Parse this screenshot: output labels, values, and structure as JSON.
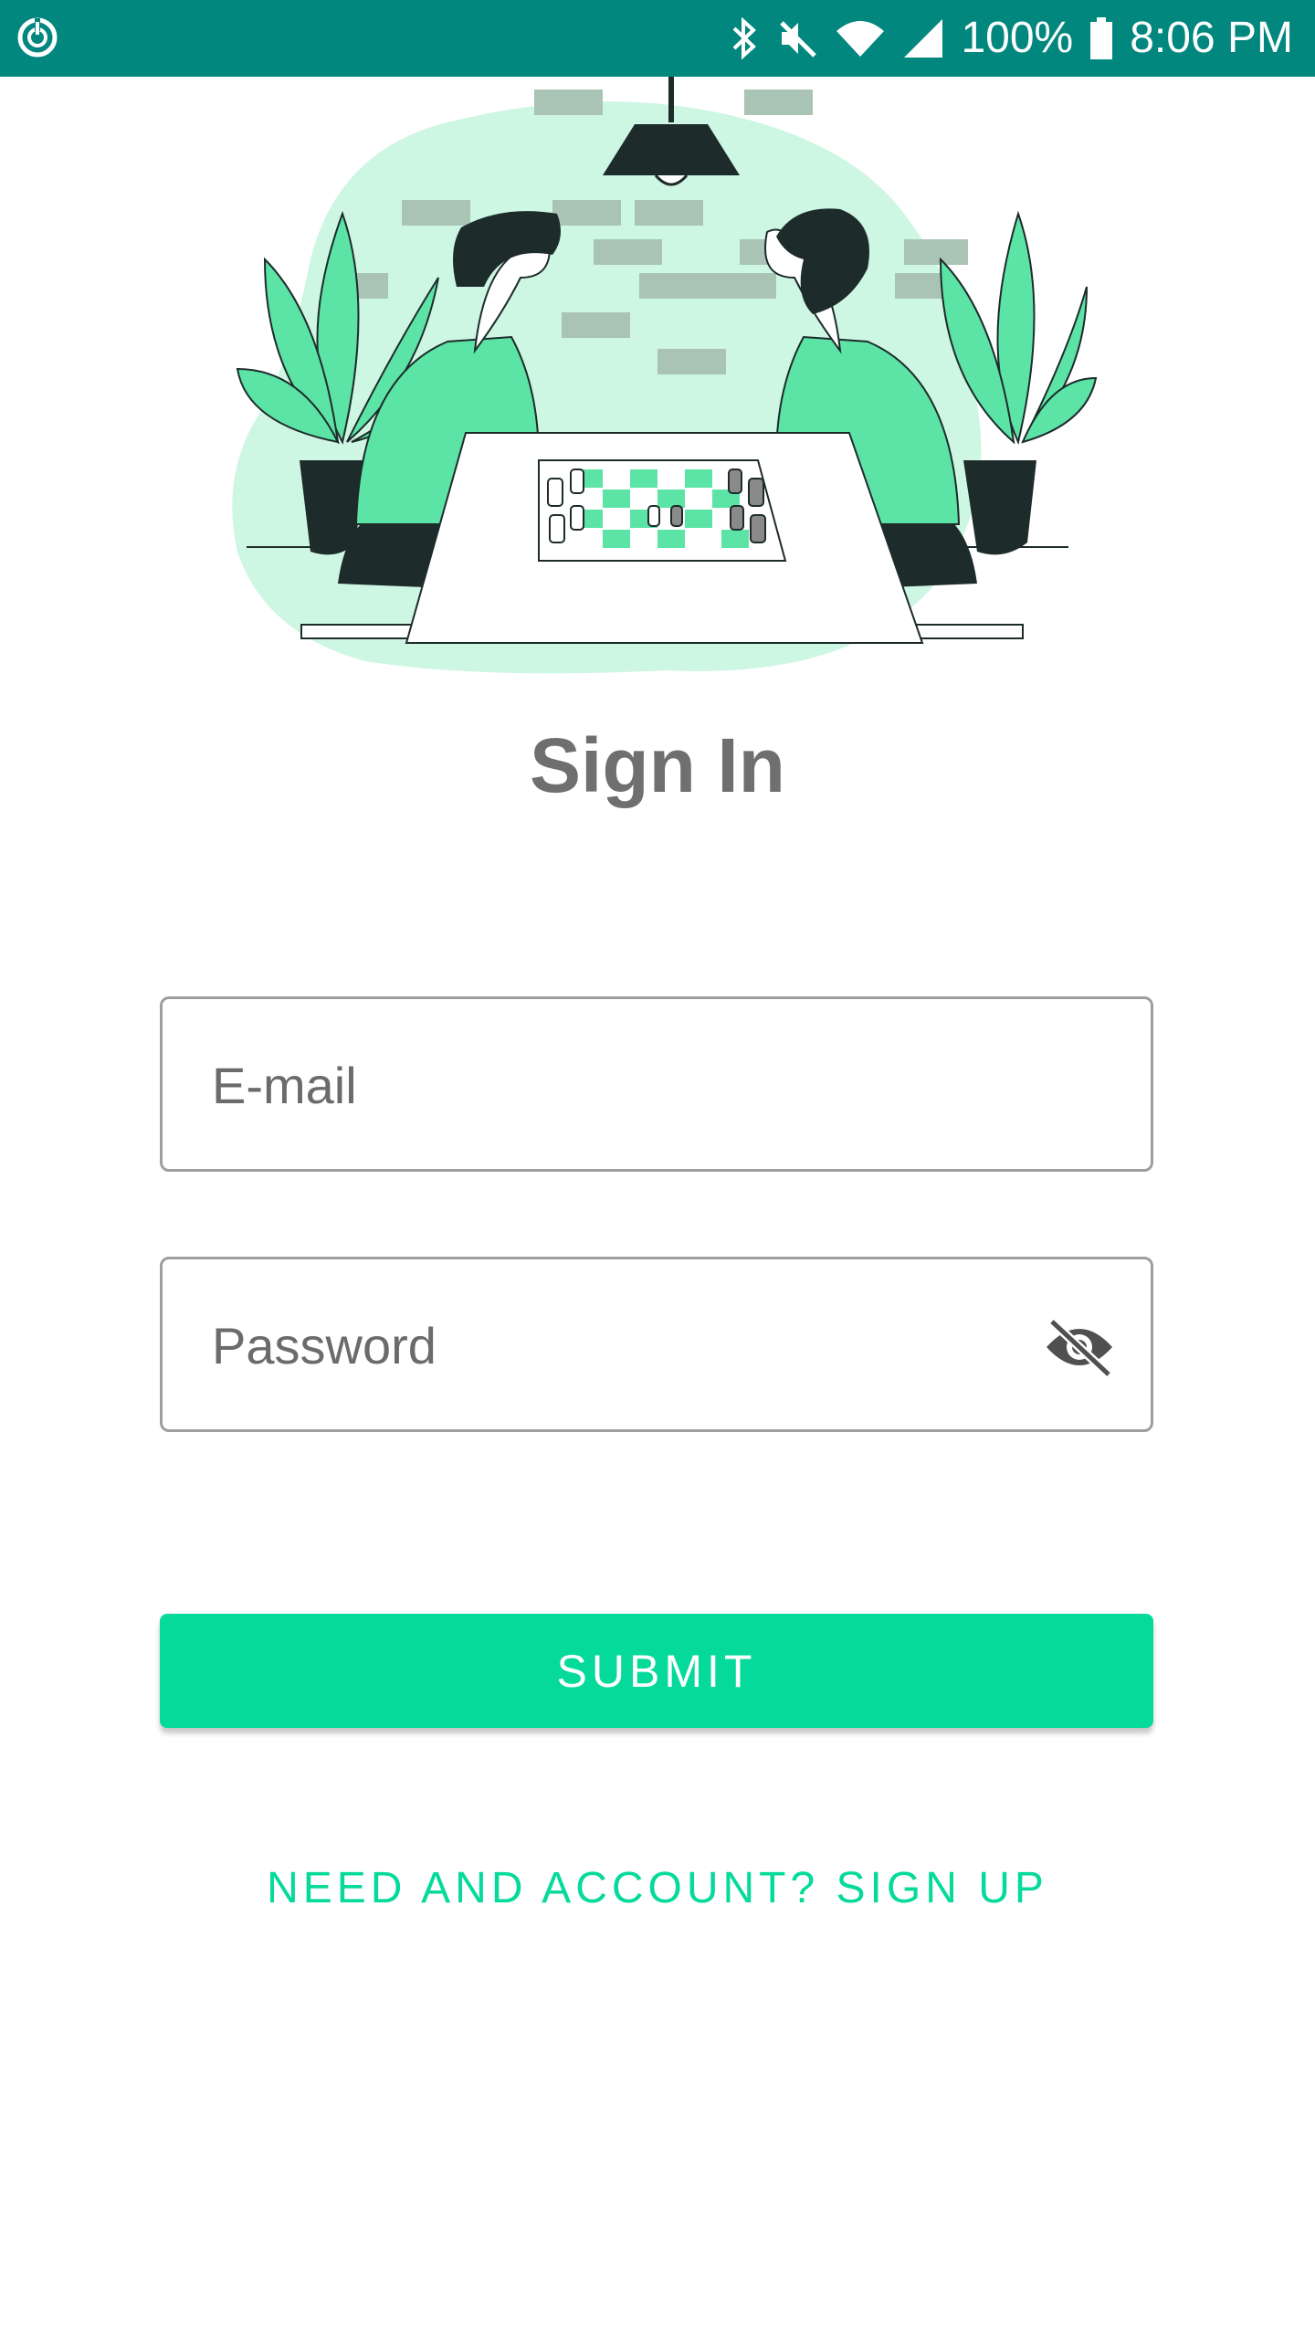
{
  "status_bar": {
    "battery_percent": "100%",
    "time": "8:06 PM",
    "icons": [
      "sync-icon",
      "bluetooth-icon",
      "mute-icon",
      "wifi-icon",
      "signal-icon",
      "battery-icon"
    ],
    "background_color": "#02877f"
  },
  "illustration": {
    "icon": "chess-players-illustration",
    "accent_color": "#5ce3a6"
  },
  "page": {
    "title": "Sign In"
  },
  "form": {
    "email_placeholder": "E-mail",
    "email_value": "",
    "password_placeholder": "Password",
    "password_value": "",
    "password_toggle_icon": "eye-off-icon",
    "submit_label": "SUBMIT",
    "submit_color": "#05da9a",
    "signup_link": "NEED AND ACCOUNT? SIGN UP"
  }
}
